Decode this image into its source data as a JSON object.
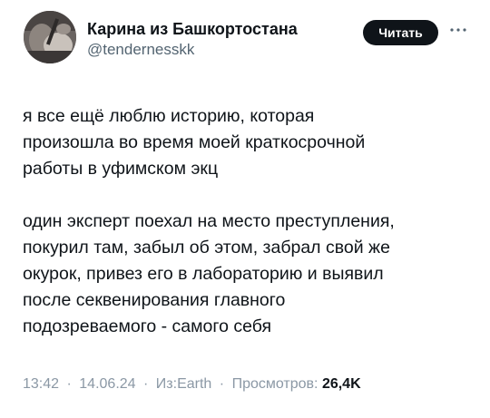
{
  "author": {
    "display_name": "Карина из Башкортостана",
    "handle": "@tendernesskk"
  },
  "actions": {
    "follow_label": "Читать",
    "more_icon": "more-dots-icon"
  },
  "tweet": {
    "paragraphs": [
      {
        "lines": [
          "я все ещё люблю историю, которая",
          "произошла во время моей краткосрочной",
          "работы в уфимском экц"
        ]
      },
      {
        "lines": [
          "один эксперт поехал на место преступления,",
          "покурил там, забыл об этом, забрал свой же",
          "окурок, привез его в лабораторию и выявил",
          "после секвенирования главного",
          "подозреваемого - самого себя"
        ]
      }
    ]
  },
  "meta": {
    "time": "13:42",
    "date": "14.06.24",
    "source": "Из:Earth",
    "views_label": "Просмотров:",
    "views_count": "26,4K",
    "separator": "·"
  },
  "colors": {
    "text": "#0f1419",
    "secondary": "#536471",
    "meta": "#8b98a5",
    "button_bg": "#0f1419"
  }
}
